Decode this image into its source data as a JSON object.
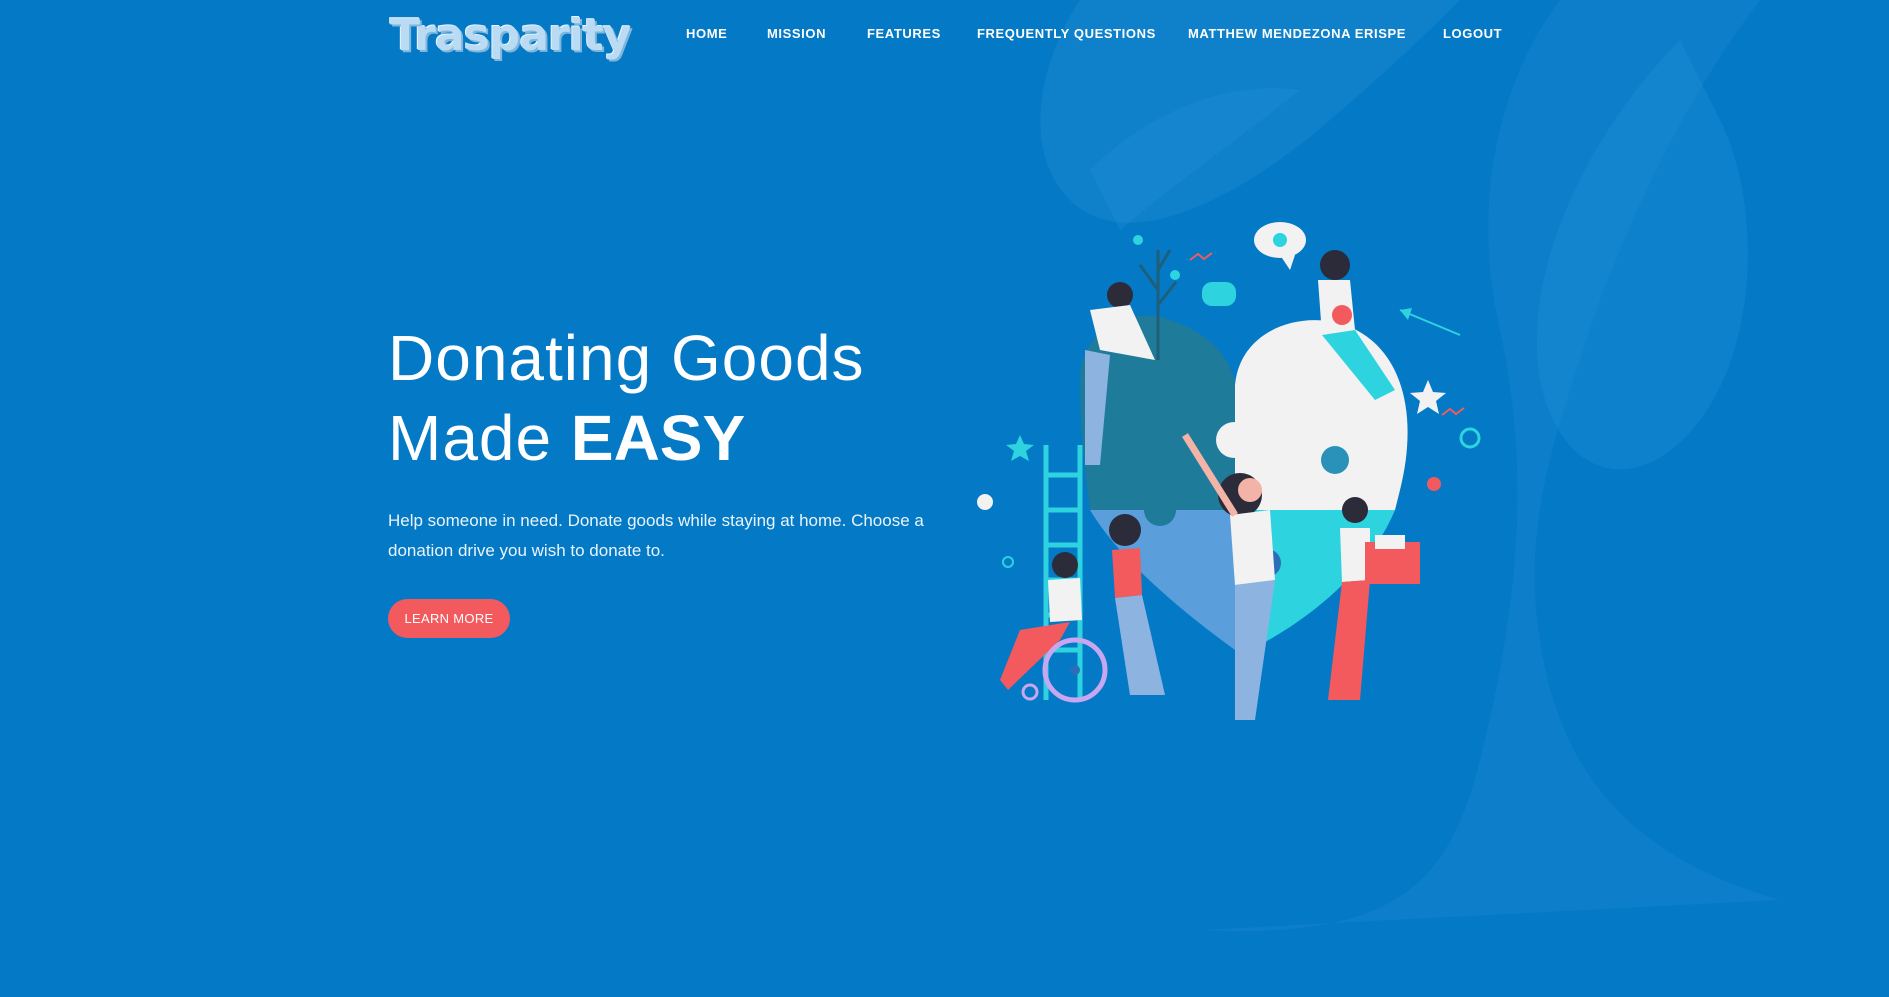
{
  "brand": {
    "logo_text": "Trasparity"
  },
  "nav": {
    "items": [
      {
        "label": "HOME"
      },
      {
        "label": "MISSION"
      },
      {
        "label": "FEATURES"
      },
      {
        "label": "FREQUENTLY QUESTIONS"
      },
      {
        "label": "MATTHEW MENDEZONA ERISPE"
      },
      {
        "label": "LOGOUT"
      }
    ]
  },
  "hero": {
    "title_line1": "Donating Goods",
    "title_line2_prefix": "Made ",
    "title_line2_bold": "EASY",
    "subtitle": "Help someone in need. Donate goods while staying at home. Choose a donation drive you wish to donate to.",
    "cta_label": "LEARN MORE"
  },
  "colors": {
    "background": "#0479c6",
    "accent": "#f25a5e",
    "text": "#ffffff"
  }
}
